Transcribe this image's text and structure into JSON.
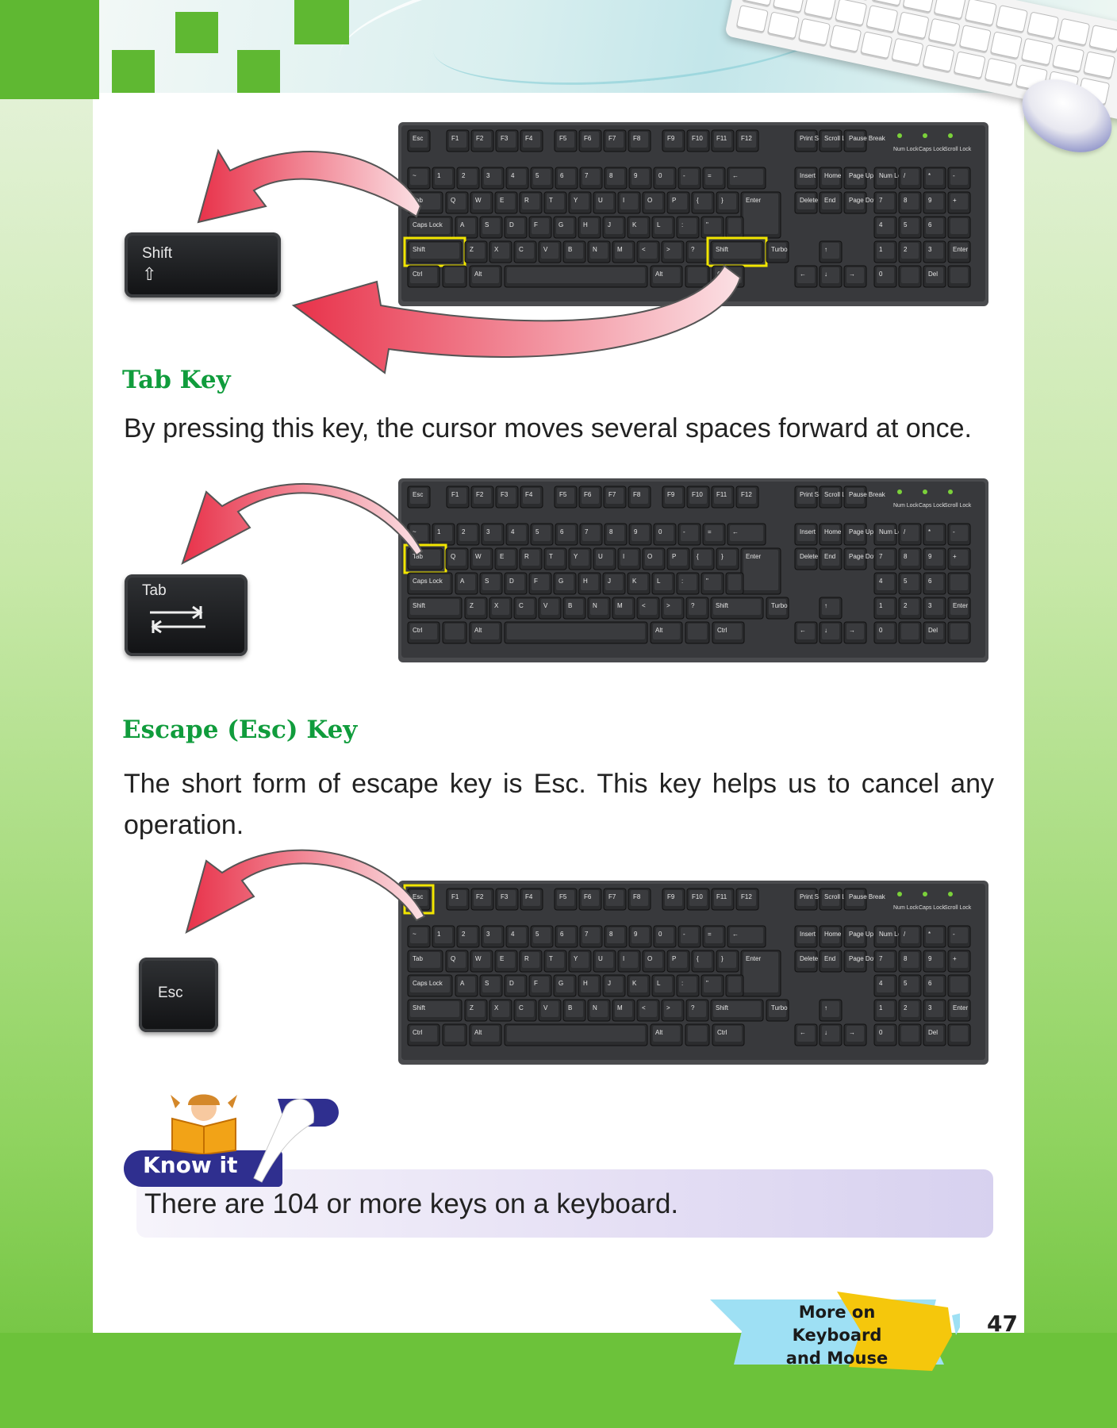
{
  "sections": {
    "tab": {
      "title": "Tab Key",
      "description": "By pressing this key, the cursor moves several spaces forward at once."
    },
    "escape": {
      "title": "Escape (Esc) Key",
      "description": "The short form of escape key is Esc. This key helps us to cancel any operation."
    }
  },
  "big_keys": {
    "shift": "Shift",
    "tab": "Tab",
    "esc": "Esc"
  },
  "keyboard": {
    "fn_row": [
      "Esc",
      "F1",
      "F2",
      "F3",
      "F4",
      "F5",
      "F6",
      "F7",
      "F8",
      "F9",
      "F10",
      "F11",
      "F12"
    ],
    "nav_top": [
      "Print Screen",
      "Scroll Lock",
      "Pause Break"
    ],
    "leds": [
      "Num Lock",
      "Caps Lock",
      "Scroll Lock"
    ],
    "number_row": [
      "~",
      "1",
      "2",
      "3",
      "4",
      "5",
      "6",
      "7",
      "8",
      "9",
      "0",
      "-",
      "=",
      "←"
    ],
    "q_row": [
      "Tab",
      "Q",
      "W",
      "E",
      "R",
      "T",
      "Y",
      "U",
      "I",
      "O",
      "P",
      "{",
      "}",
      "Enter"
    ],
    "a_row": [
      "Caps Lock",
      "A",
      "S",
      "D",
      "F",
      "G",
      "H",
      "J",
      "K",
      "L",
      ":",
      "\"",
      ""
    ],
    "z_row": [
      "Shift",
      "Z",
      "X",
      "C",
      "V",
      "B",
      "N",
      "M",
      "<",
      ">",
      "?",
      "Shift",
      "Turbo"
    ],
    "bottom_row": [
      "Ctrl",
      "",
      "Alt",
      "",
      "Alt",
      "",
      "Ctrl"
    ],
    "ins_block": [
      "Insert",
      "Home",
      "Page Up",
      "Delete",
      "End",
      "Page Down"
    ],
    "arrows": [
      "↑",
      "←",
      "↓",
      "→"
    ],
    "numpad": [
      "Num Lock",
      "/",
      "*",
      "-",
      "7",
      "8",
      "9",
      "+",
      "4",
      "5",
      "6",
      "",
      "1",
      "2",
      "3",
      "Enter",
      "0",
      "",
      "Del",
      ""
    ]
  },
  "know_it": {
    "label": "Know it",
    "text": "There are 104 or more keys on a keyboard."
  },
  "footer": {
    "chapter_line1": "More on Keyboard",
    "chapter_line2": "and Mouse",
    "page_number": "47"
  },
  "colors": {
    "heading": "#109c3c",
    "highlight": "#f2e600",
    "arrow": "#e8324a",
    "page_green": "#5fb832",
    "know_it_tag": "#2f2f8f"
  }
}
